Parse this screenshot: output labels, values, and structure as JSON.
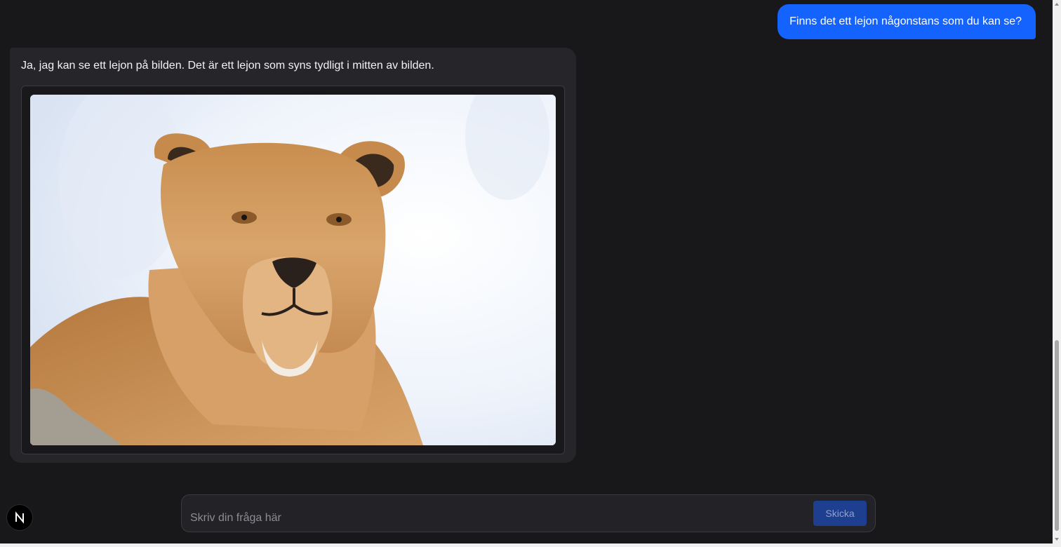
{
  "user_message": {
    "text": "Finns det ett lejon någonstans som du kan se?"
  },
  "assistant_message": {
    "text": "Ja, jag kan se ett lejon på bilden. Det är ett lejon som syns tydligt i mitten av bilden.",
    "image_icon": "lioness-photo"
  },
  "chat_input": {
    "placeholder": "Skriv din fråga här",
    "value": ""
  },
  "send_button": {
    "label": "Skicka"
  },
  "logo": {
    "letter": "N"
  },
  "colors": {
    "background": "#18181b",
    "user_bubble": "#1463ff",
    "assistant_bubble": "#26262a",
    "send_button": "#1e3e8f"
  }
}
